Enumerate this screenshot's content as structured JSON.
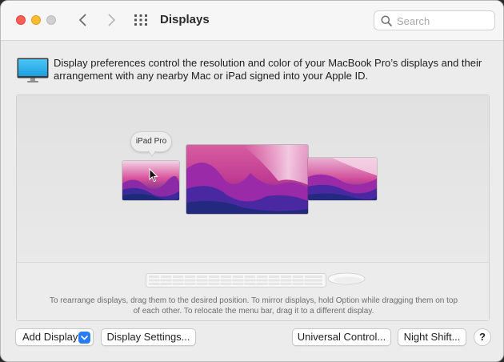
{
  "window": {
    "title": "Displays"
  },
  "search": {
    "placeholder": "Search"
  },
  "description": "Display preferences control the resolution and color of your MacBook Pro’s displays and their arrangement with any nearby Mac or iPad signed into your Apple ID.",
  "arrangement": {
    "ipad_label": "iPad Pro",
    "hint": "To rearrange displays, drag them to the desired position. To mirror displays, hold Option while dragging them on top of each other. To relocate the menu bar, drag it to a different display."
  },
  "buttons": {
    "add_display": "Add Display",
    "display_settings": "Display Settings...",
    "universal_control": "Universal Control...",
    "night_shift": "Night Shift...",
    "help": "?"
  },
  "icons": {
    "back": "chevron-left-icon",
    "forward": "chevron-right-icon",
    "grid": "grid-icon",
    "search": "search-icon",
    "monitor": "monitor-icon",
    "cursor": "cursor-icon"
  },
  "colors": {
    "close": "#fe5f57",
    "minimize": "#febc2e",
    "zoom": "#d0d0d0",
    "accent": "#2a7cf5"
  }
}
